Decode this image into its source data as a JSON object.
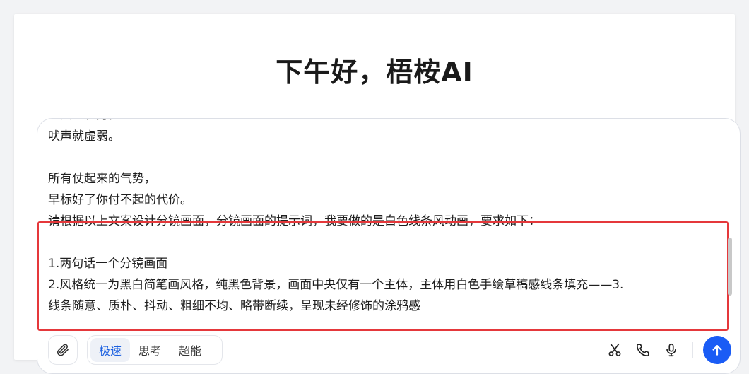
{
  "greeting": "下午好，梧桉AI",
  "composer": {
    "lines": [
      "上天一表另。",
      "吠声就虚弱。",
      "",
      "所有仗起来的气势，",
      "早标好了你付不起的代价。",
      "请根据以上文案设计分镜画面，分镜画面的提示词，我要做的是白色线条风动画，要求如下：",
      "",
      "1.两句话一个分镜画面",
      "2.风格统一为黑白简笔画风格，纯黑色背景，画面中央仅有一个主体，主体用白色手绘草稿感线条填充——3.",
      "线条随意、质朴、抖动、粗细不均、略带断续，呈现未经修饰的涂鸦感"
    ]
  },
  "toolbar": {
    "attach_icon": "paperclip-icon",
    "modes": [
      {
        "label": "极速",
        "active": true
      },
      {
        "label": "思考",
        "active": false
      },
      {
        "label": "超能",
        "active": false
      }
    ],
    "right_icons": [
      "scissors-icon",
      "phone-icon",
      "microphone-icon"
    ],
    "send_icon": "arrow-up-icon",
    "accent_color": "#1a5cf5",
    "selection_color": "#e5383b"
  }
}
